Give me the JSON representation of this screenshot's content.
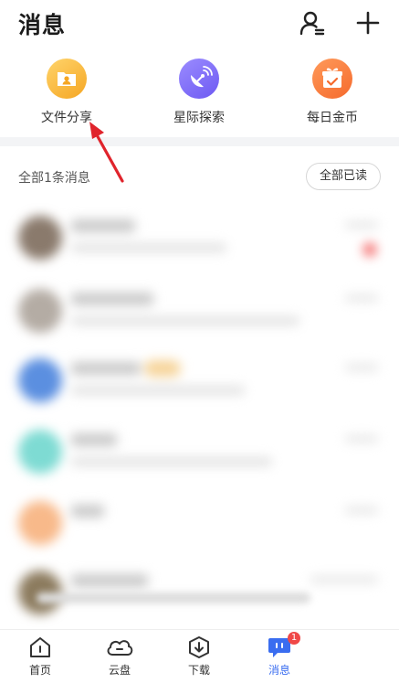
{
  "header": {
    "title": "消息"
  },
  "shortcuts": [
    {
      "label": "文件分享",
      "icon": "folder-share-icon"
    },
    {
      "label": "星际探索",
      "icon": "satellite-dish-icon"
    },
    {
      "label": "每日金币",
      "icon": "gift-icon"
    }
  ],
  "messages": {
    "summary": "全部1条消息",
    "mark_all_read": "全部已读"
  },
  "tabbar": {
    "tabs": [
      {
        "label": "首页",
        "icon": "home-icon"
      },
      {
        "label": "云盘",
        "icon": "cloud-icon"
      },
      {
        "label": "下载",
        "icon": "download-icon"
      },
      {
        "label": "消息",
        "icon": "chat-icon",
        "badge": "1",
        "active": true
      }
    ]
  },
  "colors": {
    "accent": "#3a6df0",
    "badge": "#f04848",
    "arrow": "#e0242c"
  }
}
